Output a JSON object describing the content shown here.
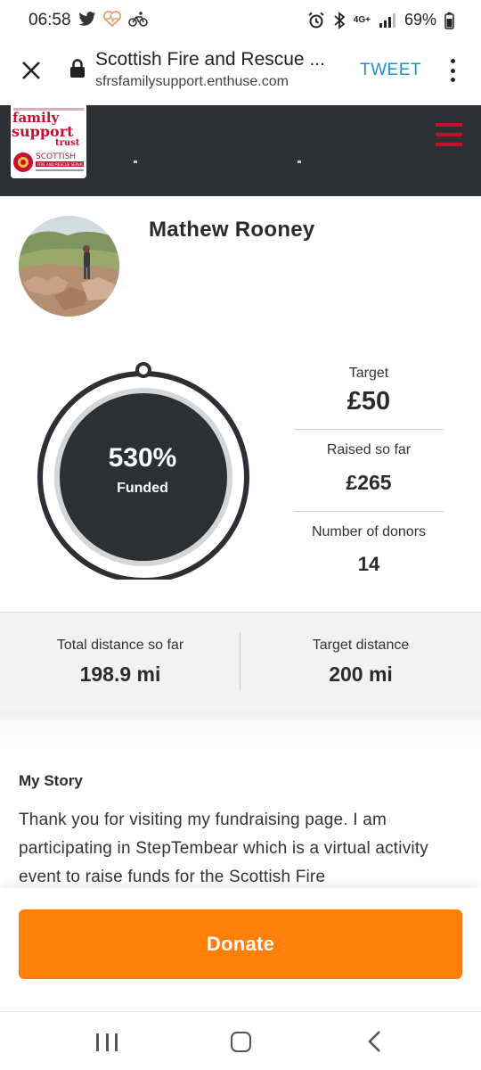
{
  "status_bar": {
    "time": "06:58",
    "battery": "69%",
    "network": "4G+",
    "icons": [
      "twitter-icon",
      "heart-health-icon",
      "cycling-icon",
      "alarm-icon",
      "bluetooth-icon",
      "signal-icon",
      "battery-icon"
    ]
  },
  "browser": {
    "title": "Scottish Fire and Rescue ...",
    "url": "sfrsfamilysupport.enthuse.com",
    "tweet_label": "TWEET"
  },
  "header": {
    "logo_text_line1": "family",
    "logo_text_line2": "support",
    "logo_text_line3": "trust",
    "logo_org": "SCOTTISH",
    "logo_org_sub": "FIRE AND RESCUE SERVICE",
    "accent_color": "#c8102e",
    "background_color": "#2c3034"
  },
  "fundraiser": {
    "name": "Mathew Rooney"
  },
  "progress": {
    "percent_text": "530%",
    "label": "Funded",
    "fraction": 1.0
  },
  "stats": {
    "target_label": "Target",
    "target_value": "£50",
    "raised_label": "Raised so far",
    "raised_value": "£265",
    "donors_label": "Number of donors",
    "donors_value": "14"
  },
  "distance": {
    "total_label": "Total distance so far",
    "total_value": "198.9 mi",
    "target_label": "Target distance",
    "target_value": "200 mi"
  },
  "story": {
    "heading": "My Story",
    "body": "Thank you for visiting my fundraising page. I am participating in StepTembear which is a virtual activity event to raise funds for the Scottish Fire"
  },
  "donate": {
    "label": "Donate",
    "color": "#ff7f0a"
  }
}
